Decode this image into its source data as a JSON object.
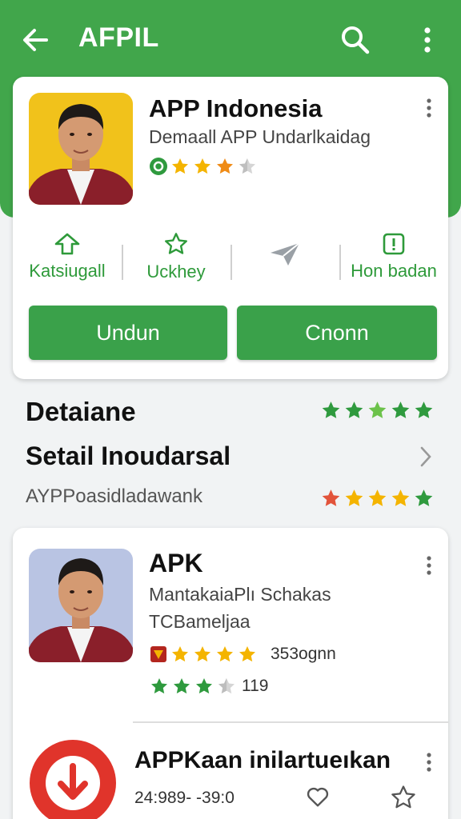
{
  "appbar": {
    "title": "AFPIL",
    "back_icon": "arrow-left-icon",
    "search_icon": "search-icon",
    "more_icon": "more-vert-icon",
    "color": "#41a64b"
  },
  "featured": {
    "name": "APP Indonesia",
    "subtitle": "Demaall APP Undarlkaidag",
    "rating_stars": 3.5,
    "actions": [
      {
        "label": "Katsiugall",
        "icon": "share-up-icon"
      },
      {
        "label": "Uckhey",
        "icon": "star-outline-icon"
      },
      {
        "label": "",
        "icon": "send-icon"
      },
      {
        "label": "Hon badan",
        "icon": "report-icon"
      }
    ],
    "buttons": {
      "primary": "Undun",
      "secondary": "Cnonn"
    }
  },
  "details": {
    "heading": "Detaiane",
    "title": "Setail Inoudarsal",
    "subtitle": "AYPPoasidladawank"
  },
  "list": [
    {
      "name": "APK",
      "line1": "MantakaiaPlı Schakas",
      "line2": "TCBameljaa",
      "rating_count": "353ognn",
      "rating_count2": "119"
    },
    {
      "name": "APPKaan inilartueıkan",
      "meta": "24:989- -39:0"
    }
  ]
}
